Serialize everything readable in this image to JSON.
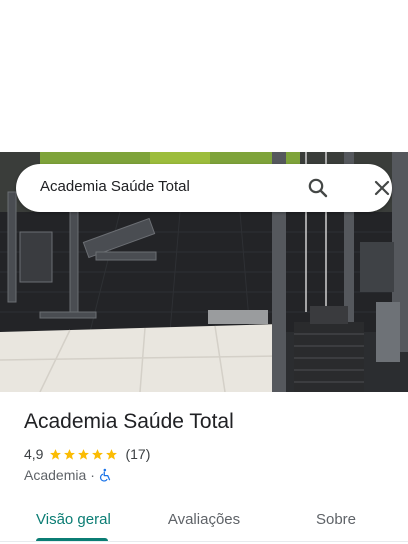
{
  "search": {
    "query": "Academia Saúde Total"
  },
  "place": {
    "title": "Academia Saúde Total",
    "rating": "4,9",
    "stars": 5,
    "review_count": "(17)",
    "category": "Academia",
    "separator": "·"
  },
  "icons": {
    "search": "search-icon",
    "close": "close-icon",
    "star": "star-icon",
    "accessible": "wheelchair-icon"
  },
  "tabs": [
    {
      "label": "Visão geral",
      "active": true
    },
    {
      "label": "Avaliações",
      "active": false
    },
    {
      "label": "Sobre",
      "active": false
    }
  ],
  "colors": {
    "accent": "#0b7d74",
    "star": "#fbbc04",
    "accessible": "#1a73e8"
  }
}
